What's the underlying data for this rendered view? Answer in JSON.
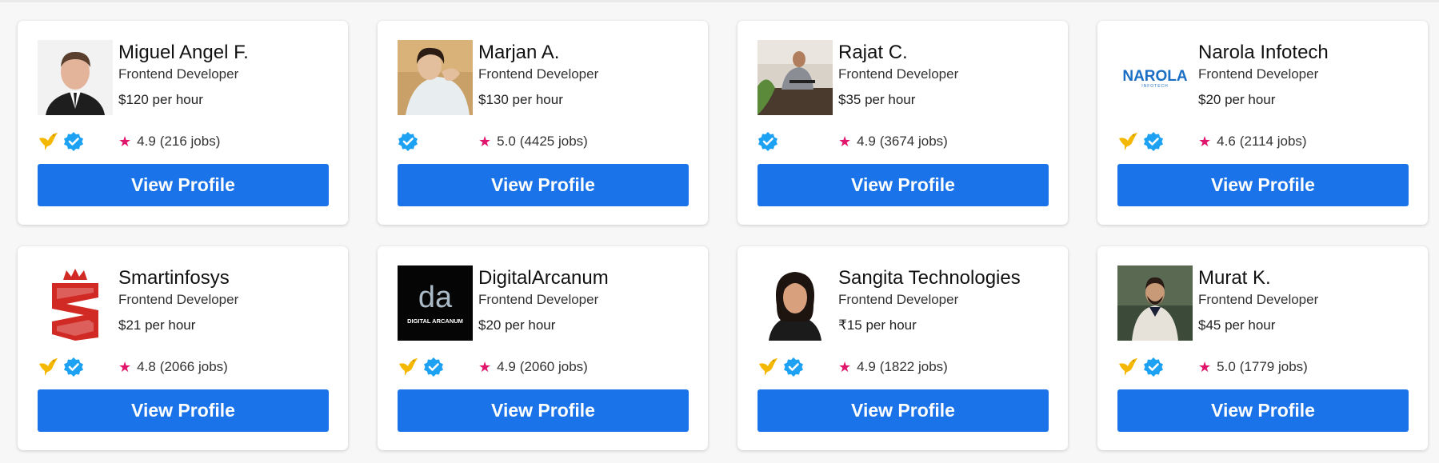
{
  "colors": {
    "accent": "#1a73e8",
    "star": "#e0156b",
    "verified": "#1da1f2",
    "bird": "#f5b800"
  },
  "cards": [
    {
      "name": "Miguel Angel F.",
      "title": "Frontend Developer",
      "rate": "$120 per hour",
      "rating": "4.9",
      "jobs": "(216 jobs)",
      "bird": true,
      "verified": true,
      "avatar": "photo-man-suit",
      "button": "View Profile"
    },
    {
      "name": "Marjan A.",
      "title": "Frontend Developer",
      "rate": "$130 per hour",
      "rating": "5.0",
      "jobs": "(4425 jobs)",
      "bird": false,
      "verified": true,
      "avatar": "photo-woman",
      "button": "View Profile"
    },
    {
      "name": "Rajat C.",
      "title": "Frontend Developer",
      "rate": "$35 per hour",
      "rating": "4.9",
      "jobs": "(3674 jobs)",
      "bird": false,
      "verified": true,
      "avatar": "photo-man-desk",
      "button": "View Profile"
    },
    {
      "name": "Narola Infotech",
      "title": "Frontend Developer",
      "rate": "$20 per hour",
      "rating": "4.6",
      "jobs": "(2114 jobs)",
      "bird": true,
      "verified": true,
      "avatar": "logo-narola",
      "logo_text": "NAROLA",
      "logo_sub": "INFOTECH",
      "button": "View Profile"
    },
    {
      "name": "Smartinfosys",
      "title": "Frontend Developer",
      "rate": "$21 per hour",
      "rating": "4.8",
      "jobs": "(2066 jobs)",
      "bird": true,
      "verified": true,
      "avatar": "logo-smartinfosys",
      "button": "View Profile"
    },
    {
      "name": "DigitalArcanum",
      "title": "Frontend Developer",
      "rate": "$20 per hour",
      "rating": "4.9",
      "jobs": "(2060 jobs)",
      "bird": true,
      "verified": true,
      "avatar": "logo-digital-arcanum",
      "logo_text": "da",
      "logo_sub": "DIGITAL ARCANUM",
      "button": "View Profile"
    },
    {
      "name": "Sangita Technologies",
      "title": "Frontend Developer",
      "rate": "₹15 per hour",
      "rating": "4.9",
      "jobs": "(1822 jobs)",
      "bird": true,
      "verified": true,
      "avatar": "photo-woman-portrait",
      "button": "View Profile"
    },
    {
      "name": "Murat K.",
      "title": "Frontend Developer",
      "rate": "$45 per hour",
      "rating": "5.0",
      "jobs": "(1779 jobs)",
      "bird": true,
      "verified": true,
      "avatar": "photo-man-white-suit",
      "button": "View Profile"
    }
  ]
}
